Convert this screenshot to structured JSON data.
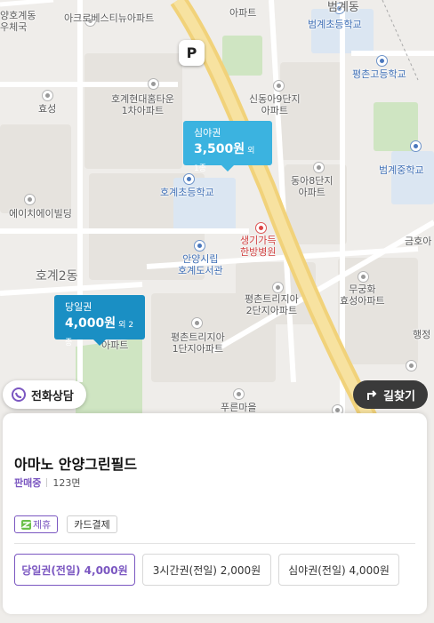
{
  "map": {
    "labels": [
      {
        "id": "post-office",
        "text": "양호계동\n우체국",
        "color": "gray"
      },
      {
        "id": "acro",
        "text": "아크로베스티뉴아파트",
        "color": "gray"
      },
      {
        "id": "apt-top",
        "text": "아파트",
        "color": "gray"
      },
      {
        "id": "beomgye",
        "text": "범계동",
        "color": "gray"
      },
      {
        "id": "beomgye-es",
        "text": "범계초등학교",
        "color": "blue"
      },
      {
        "id": "pyeongchon-hs",
        "text": "평촌고등학교",
        "color": "blue"
      },
      {
        "id": "hogye-hyundai",
        "text": "호계현대홈타운\n1차아파트",
        "color": "gray"
      },
      {
        "id": "sindong9",
        "text": "신동아9단지\n아파트",
        "color": "gray"
      },
      {
        "id": "hyoseong",
        "text": "효성",
        "color": "gray"
      },
      {
        "id": "beomgye-ms",
        "text": "범계중학교",
        "color": "blue"
      },
      {
        "id": "dong8",
        "text": "동아8단지\n아파트",
        "color": "gray"
      },
      {
        "id": "hogye-es",
        "text": "호계초등학교",
        "color": "blue"
      },
      {
        "id": "hbuilding",
        "text": "에이치에이빌딩",
        "color": "gray"
      },
      {
        "id": "saenggi",
        "text": "생기가득\n한방병원",
        "color": "red"
      },
      {
        "id": "anyang-lib",
        "text": "안양시립\n호계도서관",
        "color": "blue"
      },
      {
        "id": "geumho",
        "text": "금호아",
        "color": "gray"
      },
      {
        "id": "hogye2",
        "text": "호계2동",
        "color": "big"
      },
      {
        "id": "trizia2",
        "text": "평촌트리지아\n2단지아파트",
        "color": "gray"
      },
      {
        "id": "mugunghwa",
        "text": "무궁화\n효성아파트",
        "color": "gray"
      },
      {
        "id": "apt-mid",
        "text": "아파트",
        "color": "gray"
      },
      {
        "id": "trizia1",
        "text": "평촌트리지아\n1단지아파트",
        "color": "gray"
      },
      {
        "id": "haengjeong",
        "text": "행정",
        "color": "gray"
      },
      {
        "id": "pureun",
        "text": "푸른마을",
        "color": "gray"
      }
    ]
  },
  "parking_pin": "P",
  "price_tags": {
    "night": {
      "type": "심야권",
      "price": "3,500원",
      "extra": "외 1종"
    },
    "day": {
      "type": "당일권",
      "price": "4,000원",
      "extra": "외 2종"
    }
  },
  "buttons": {
    "call": "전화상담",
    "route": "길찾기"
  },
  "sheet": {
    "name": "아마노 안양그린필드",
    "status": "판매중",
    "spaces": "123면",
    "tags": [
      "제휴",
      "카드결제"
    ],
    "tickets": [
      "당일권(전일) 4,000원",
      "3시간권(전일) 2,000원",
      "심야권(전일) 4,000원"
    ]
  },
  "colors": {
    "accent": "#7b57c1",
    "night_tag": "#3bb3e0",
    "day_tag": "#1a8fc4",
    "dark_button": "#3a3a3a"
  }
}
